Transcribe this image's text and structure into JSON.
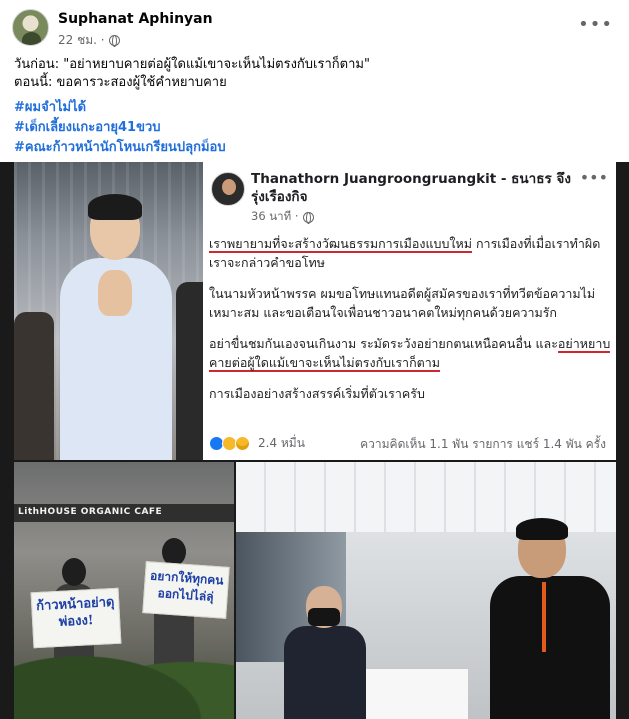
{
  "post": {
    "author": "Suphanat Aphinyan",
    "time": "22 ชม. ·",
    "line1": "วันก่อน: \"อย่าหยาบคายต่อผู้ใดแม้เขาจะเห็นไม่ตรงกับเราก็ตาม\"",
    "line2": "ตอนนี้: ขอคารวะสองผู้ใช้คำหยาบคาย",
    "hashtags": [
      "#ผมจำไม่ได้",
      "#เด็กเลี้ยงแกะอายุ41ขวบ",
      "#คณะก้าวหน้านักโหนเกรียนปลุกม็อบ"
    ]
  },
  "embedded_post": {
    "author": "Thanathorn Juangroongruangkit - ธนาธร จึงรุ่งเรืองกิจ",
    "time": "36 นาที ·",
    "p1_underlined": "เราพยายามที่จะสร้างวัฒนธรรมการเมืองแบบใหม่",
    "p1_rest": " การเมืองที่เมื่อเราทำผิด เราจะกล่าวคำขอโทษ",
    "p2": "ในนามหัวหน้าพรรค ผมขอโทษแทนอดีตผู้สมัครของเราที่ทวีตข้อความไม่เหมาะสม และขอเตือนใจเพื่อนชาวอนาคตใหม่ทุกคนด้วยความรัก",
    "p3_start": "อย่าขื่นชมกันเองจนเกินงาม ระมัดระวังอย่ายกตนเหนือคนอื่น และ",
    "p3_underlined": "อย่าหยาบคายต่อผู้ใดแม้เขาจะเห็นไม่ตรงกับเราก็ตาม",
    "p4": "การเมืองอย่างสร้างสรรค์เริ่มที่ตัวเราครับ",
    "reaction_count": "2.4 หมื่น",
    "stats": "ความคิดเห็น 1.1 พัน รายการ   แชร์ 1.4 พัน ครั้ง"
  },
  "photos": {
    "store_sign": "LithHOUSE ORGANIC CAFE",
    "placard_1": "ก้าวหน้าอย่าดุพ่องง!",
    "placard_2": "อยากให้ทุกคนออกไปไล่ลุ่",
    "brand_accent": "#216fdb",
    "underline_color": "#d0262f"
  }
}
